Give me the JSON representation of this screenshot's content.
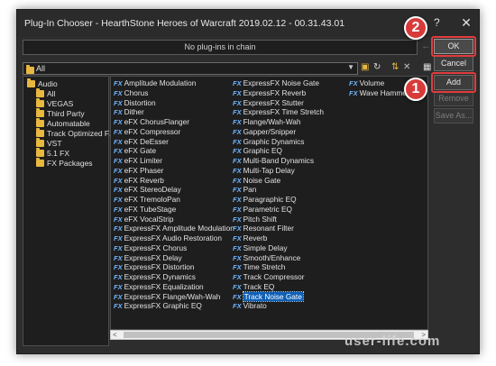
{
  "window": {
    "title": "Plug-In Chooser - HearthStone  Heroes of Warcraft 2019.02.12 - 00.31.43.01",
    "help_symbol": "?",
    "close_symbol": "✕"
  },
  "chain": {
    "status_text": "No plug-ins in chain",
    "arrows": "←→"
  },
  "buttons": {
    "ok": "OK",
    "cancel": "Cancel",
    "add": "Add",
    "remove": "Remove",
    "save_as": "Save As..."
  },
  "annotations": {
    "step1": "1",
    "step2": "2",
    "highlight_color": "#e23c3c"
  },
  "folder_select": {
    "value": "All",
    "caret": "▼"
  },
  "toolbar_icons": [
    "export-icon",
    "refresh-icon",
    "sort-icon",
    "delete-icon",
    "view-icon"
  ],
  "tree": {
    "root": "Audio",
    "items": [
      "All",
      "VEGAS",
      "Third Party",
      "Automatable",
      "Track Optimized FX",
      "VST",
      "5.1 FX",
      "FX Packages"
    ]
  },
  "plugins": {
    "col1": [
      "Amplitude Modulation",
      "Chorus",
      "Distortion",
      "Dither",
      "eFX ChorusFlanger",
      "eFX Compressor",
      "eFX DeEsser",
      "eFX Gate",
      "eFX Limiter",
      "eFX Phaser",
      "eFX Reverb",
      "eFX StereoDelay",
      "eFX TremoloPan",
      "eFX TubeStage",
      "eFX VocalStrip",
      "ExpressFX Amplitude Modulation",
      "ExpressFX Audio Restoration",
      "ExpressFX Chorus",
      "ExpressFX Delay",
      "ExpressFX Distortion",
      "ExpressFX Dynamics",
      "ExpressFX Equalization",
      "ExpressFX Flange/Wah-Wah",
      "ExpressFX Graphic EQ"
    ],
    "col2": [
      "ExpressFX Noise Gate",
      "ExpressFX Reverb",
      "ExpressFX Stutter",
      "ExpressFX Time Stretch",
      "Flange/Wah-Wah",
      "Gapper/Snipper",
      "Graphic Dynamics",
      "Graphic EQ",
      "Multi-Band Dynamics",
      "Multi-Tap Delay",
      "Noise Gate",
      "Pan",
      "Paragraphic EQ",
      "Parametric EQ",
      "Pitch Shift",
      "Resonant Filter",
      "Reverb",
      "Simple Delay",
      "Smooth/Enhance",
      "Time Stretch",
      "Track Compressor",
      "Track EQ",
      "Track Noise Gate",
      "Vibrato"
    ],
    "col3": [
      "Volume",
      "Wave Hammer"
    ],
    "fx_badge": "FX",
    "selected": "Track Noise Gate"
  },
  "scrollbar": {
    "left_arrow": "<",
    "right_arrow": ">"
  },
  "watermark": "user-life.com"
}
